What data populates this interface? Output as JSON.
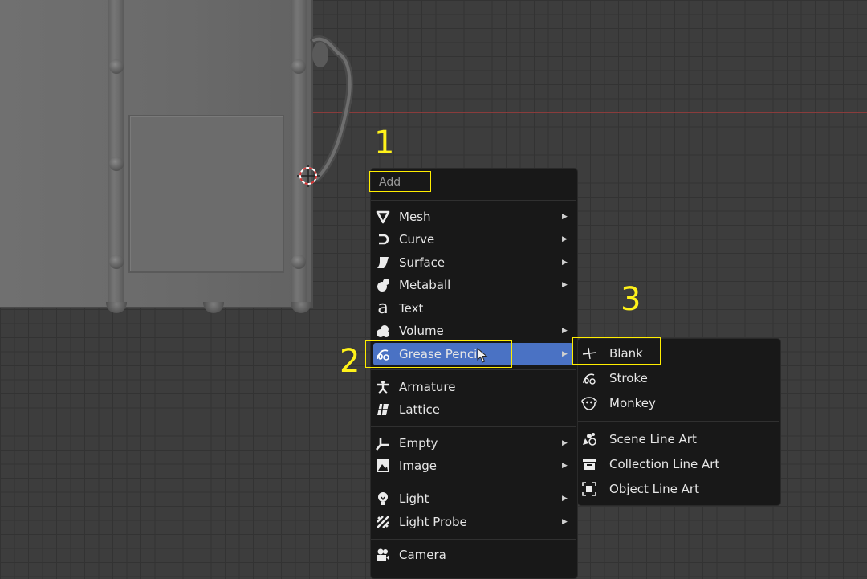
{
  "markers": [
    "1",
    "2",
    "3"
  ],
  "menu": {
    "title": "Add",
    "groups": [
      [
        {
          "label": "Mesh",
          "icon": "mesh-icon",
          "submenu": true
        },
        {
          "label": "Curve",
          "icon": "curve-icon",
          "submenu": true
        },
        {
          "label": "Surface",
          "icon": "surface-icon",
          "submenu": true
        },
        {
          "label": "Metaball",
          "icon": "metaball-icon",
          "submenu": true
        },
        {
          "label": "Text",
          "icon": "text-icon",
          "submenu": false
        },
        {
          "label": "Volume",
          "icon": "volume-icon",
          "submenu": true
        },
        {
          "label": "Grease Pencil",
          "icon": "grease-pencil-icon",
          "submenu": true,
          "active": true
        }
      ],
      [
        {
          "label": "Armature",
          "icon": "armature-icon",
          "submenu": false
        },
        {
          "label": "Lattice",
          "icon": "lattice-icon",
          "submenu": false
        }
      ],
      [
        {
          "label": "Empty",
          "icon": "empty-icon",
          "submenu": true
        },
        {
          "label": "Image",
          "icon": "image-icon",
          "submenu": true
        }
      ],
      [
        {
          "label": "Light",
          "icon": "light-icon",
          "submenu": true
        },
        {
          "label": "Light Probe",
          "icon": "light-probe-icon",
          "submenu": true
        }
      ],
      [
        {
          "label": "Camera",
          "icon": "camera-icon",
          "submenu": false
        }
      ]
    ]
  },
  "submenu": {
    "groups": [
      [
        {
          "label": "Blank",
          "icon": "blank-icon"
        },
        {
          "label": "Stroke",
          "icon": "stroke-icon"
        },
        {
          "label": "Monkey",
          "icon": "monkey-icon"
        }
      ],
      [
        {
          "label": "Scene Line Art",
          "icon": "scene-line-art-icon"
        },
        {
          "label": "Collection Line Art",
          "icon": "collection-line-art-icon"
        },
        {
          "label": "Object Line Art",
          "icon": "object-line-art-icon"
        }
      ]
    ]
  },
  "colors": {
    "menu_bg": "#181818",
    "highlight": "#4a72c4",
    "annotation": "#ffee00",
    "viewport_bg": "#3d3d3d"
  }
}
